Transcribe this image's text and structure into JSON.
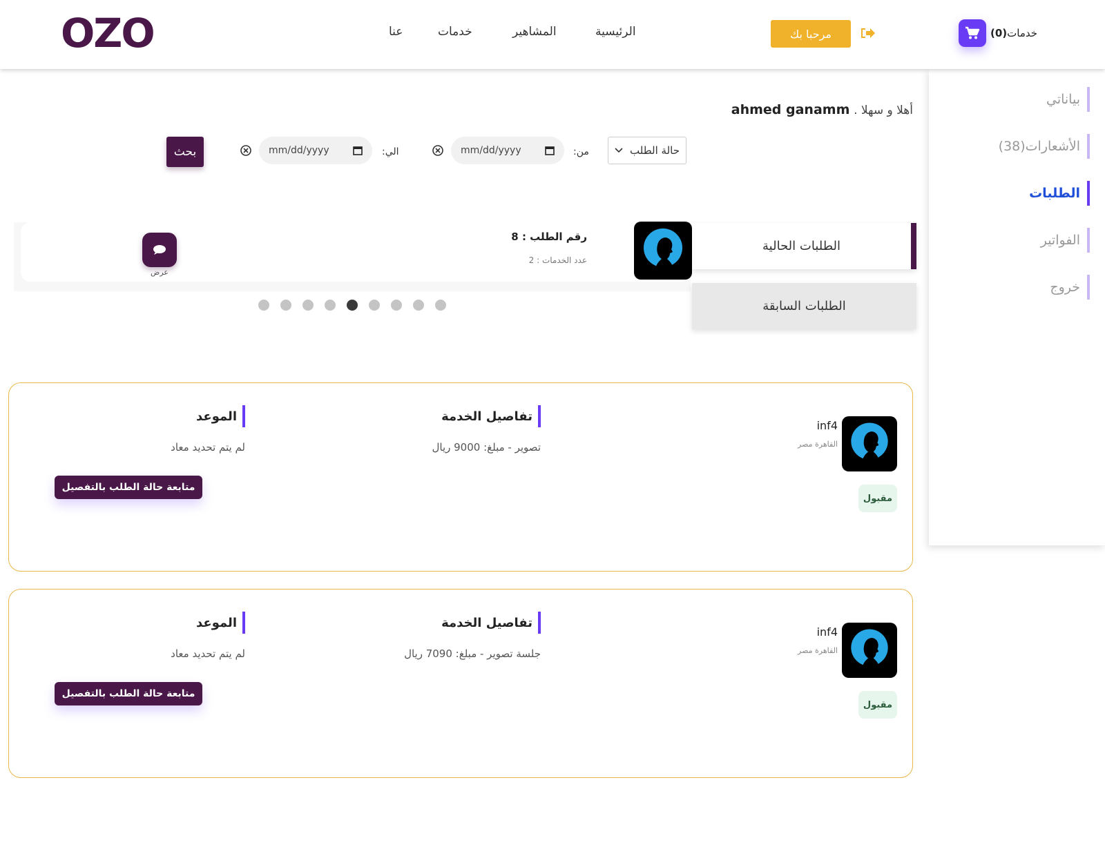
{
  "header": {
    "logo_text": "OZO",
    "nav": [
      "الرئيسية",
      "المشاهير",
      "خدمات",
      "عنا"
    ],
    "welcome_button": "مرحبا بك",
    "cart_label": "خدمات",
    "cart_count": "(0)"
  },
  "sidebar": {
    "items": [
      {
        "label": "بياناتي"
      },
      {
        "label": "الأشعارات(38)"
      },
      {
        "label": "الطلبات"
      },
      {
        "label": "الفواتير"
      },
      {
        "label": "خروج"
      }
    ],
    "active_index": 2
  },
  "greeting": {
    "hello": "أهلا و سهلا .",
    "name": "ahmed ganamm"
  },
  "filters": {
    "status_placeholder": "حالة الطلب",
    "from_label": "من:",
    "to_label": "الي:",
    "date_placeholder": "mm/dd/yyyy",
    "search_button": "بحث"
  },
  "carousel": {
    "order_title": "رقم الطلب : 8",
    "service_count": "عدد الخدمات : 2",
    "view_label": "عرض",
    "dot_count": 9,
    "active_dot": 4
  },
  "tabs": {
    "current": "الطلبات الحالية",
    "previous": "الطلبات السابقة"
  },
  "orders": [
    {
      "user_name": "inf4",
      "location": "القاهرة مصر",
      "status": "مقبول",
      "details_title": "تفاصيل الخدمة",
      "details_value": "تصوير - مبلغ: 9000 ريال",
      "date_title": "الموعد",
      "date_value": "لم يتم تحديد معاد",
      "follow_button": "متابعة حالة الطلب بالتفصيل"
    },
    {
      "user_name": "inf4",
      "location": "القاهرة مصر",
      "status": "مقبول",
      "details_title": "تفاصيل الخدمة",
      "details_value": "جلسة تصوير - مبلغ: 7090 ريال",
      "date_title": "الموعد",
      "date_value": "لم يتم تحديد معاد",
      "follow_button": "متابعة حالة الطلب بالتفصيل"
    }
  ],
  "colors": {
    "brand_purple": "#4a1848",
    "accent_violet": "#6a3bf5",
    "welcome_yellow": "#f0b12b",
    "active_blue": "#1f4fd8",
    "card_border": "#e8b84a"
  }
}
